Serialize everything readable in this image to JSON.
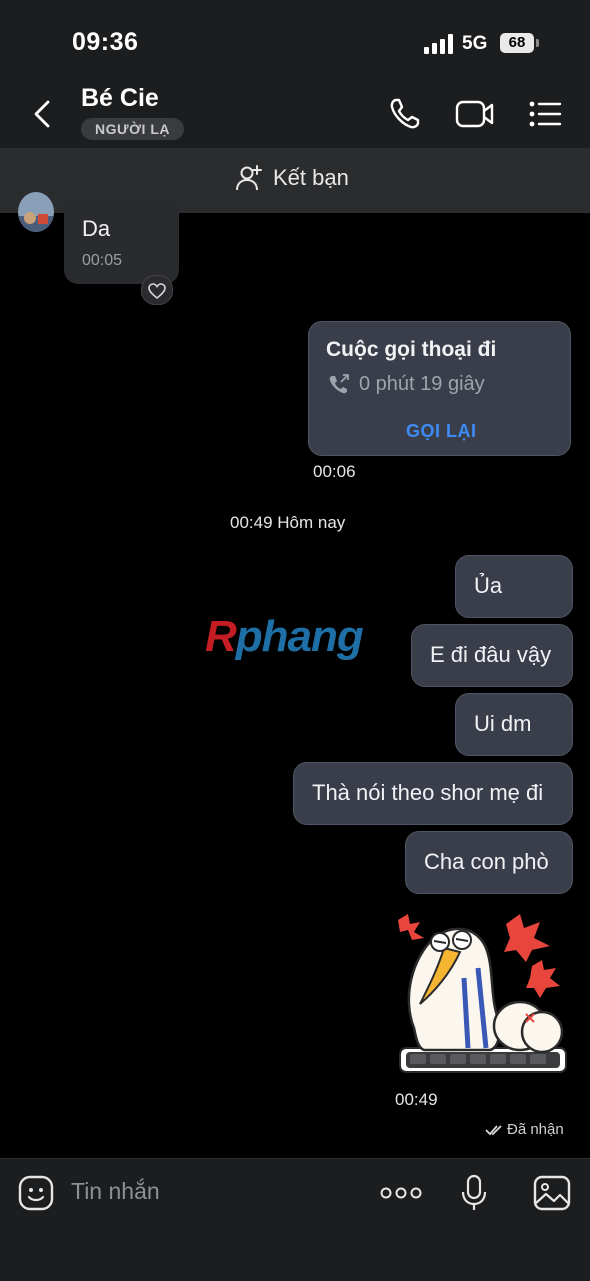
{
  "status_bar": {
    "time": "09:36",
    "network": "5G",
    "battery": "68"
  },
  "header": {
    "contact_name": "Bé Cie",
    "badge": "NGƯỜI LẠ"
  },
  "friend_bar": {
    "label": "Kết bạn"
  },
  "messages": {
    "incoming": {
      "text": "Da",
      "time": "00:05"
    },
    "call": {
      "title": "Cuộc gọi thoại đi",
      "duration": "0 phút 19 giây",
      "action": "GỌI LẠI",
      "time": "00:06"
    },
    "separator": "00:49 Hôm nay",
    "outgoing": [
      "Ủa",
      "E đi đâu vậy",
      "Ui dm",
      "Thà nói theo shor mẹ đi",
      "Cha con phò"
    ],
    "sticker_time": "00:49",
    "delivery_status": "Đã nhận"
  },
  "watermark": {
    "first": "R",
    "rest": "phang"
  },
  "composer": {
    "placeholder": "Tin nhắn"
  },
  "colors": {
    "accent": "#3d8cf5",
    "outgoing_bubble": "#393e4a",
    "background": "#000000"
  }
}
